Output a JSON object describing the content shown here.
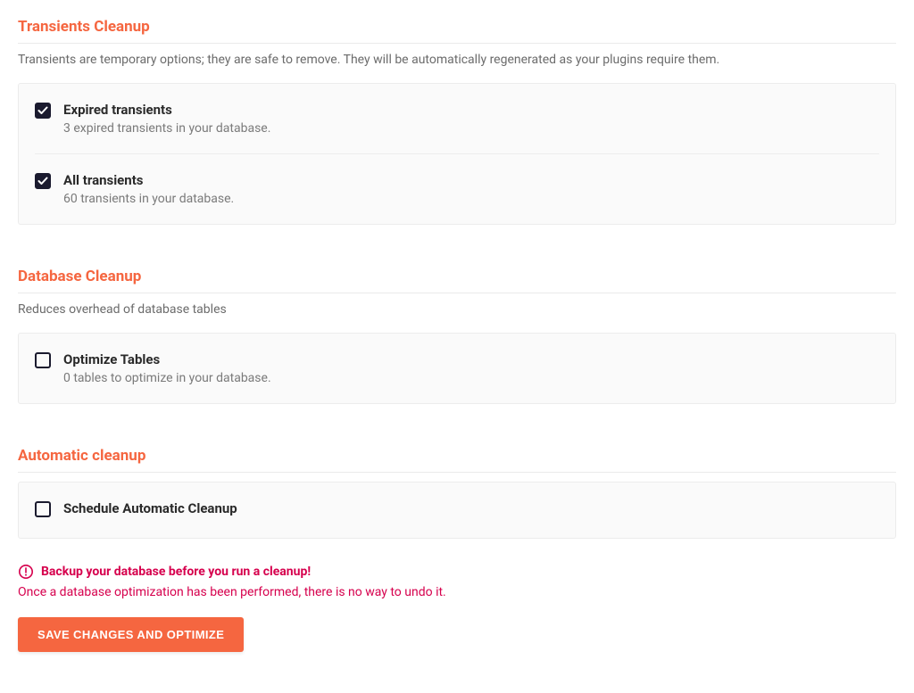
{
  "transients": {
    "title": "Transients Cleanup",
    "desc": "Transients are temporary options; they are safe to remove. They will be automatically regenerated as your plugins require them.",
    "items": [
      {
        "title": "Expired transients",
        "sub": "3 expired transients in your database.",
        "checked": true
      },
      {
        "title": "All transients",
        "sub": "60 transients in your database.",
        "checked": true
      }
    ]
  },
  "database": {
    "title": "Database Cleanup",
    "desc": "Reduces overhead of database tables",
    "items": [
      {
        "title": "Optimize Tables",
        "sub": "0 tables to optimize in your database.",
        "checked": false
      }
    ]
  },
  "automatic": {
    "title": "Automatic cleanup",
    "items": [
      {
        "title": "Schedule Automatic Cleanup",
        "checked": false
      }
    ]
  },
  "warning": {
    "headline": "Backup your database before you run a cleanup!",
    "sub": "Once a database optimization has been performed, there is no way to undo it."
  },
  "button": {
    "label": "SAVE CHANGES AND OPTIMIZE"
  }
}
